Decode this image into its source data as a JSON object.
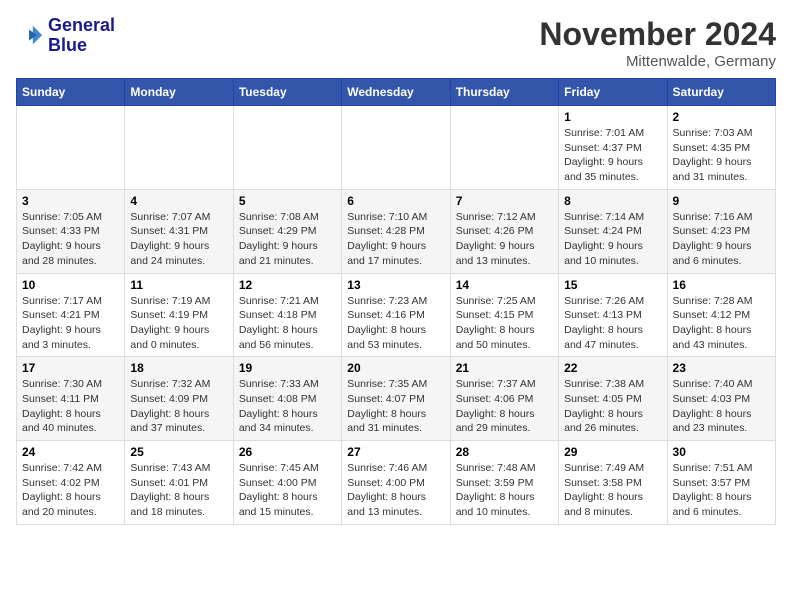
{
  "header": {
    "logo_line1": "General",
    "logo_line2": "Blue",
    "month_title": "November 2024",
    "location": "Mittenwalde, Germany"
  },
  "weekdays": [
    "Sunday",
    "Monday",
    "Tuesday",
    "Wednesday",
    "Thursday",
    "Friday",
    "Saturday"
  ],
  "weeks": [
    [
      {
        "day": "",
        "info": ""
      },
      {
        "day": "",
        "info": ""
      },
      {
        "day": "",
        "info": ""
      },
      {
        "day": "",
        "info": ""
      },
      {
        "day": "",
        "info": ""
      },
      {
        "day": "1",
        "info": "Sunrise: 7:01 AM\nSunset: 4:37 PM\nDaylight: 9 hours\nand 35 minutes."
      },
      {
        "day": "2",
        "info": "Sunrise: 7:03 AM\nSunset: 4:35 PM\nDaylight: 9 hours\nand 31 minutes."
      }
    ],
    [
      {
        "day": "3",
        "info": "Sunrise: 7:05 AM\nSunset: 4:33 PM\nDaylight: 9 hours\nand 28 minutes."
      },
      {
        "day": "4",
        "info": "Sunrise: 7:07 AM\nSunset: 4:31 PM\nDaylight: 9 hours\nand 24 minutes."
      },
      {
        "day": "5",
        "info": "Sunrise: 7:08 AM\nSunset: 4:29 PM\nDaylight: 9 hours\nand 21 minutes."
      },
      {
        "day": "6",
        "info": "Sunrise: 7:10 AM\nSunset: 4:28 PM\nDaylight: 9 hours\nand 17 minutes."
      },
      {
        "day": "7",
        "info": "Sunrise: 7:12 AM\nSunset: 4:26 PM\nDaylight: 9 hours\nand 13 minutes."
      },
      {
        "day": "8",
        "info": "Sunrise: 7:14 AM\nSunset: 4:24 PM\nDaylight: 9 hours\nand 10 minutes."
      },
      {
        "day": "9",
        "info": "Sunrise: 7:16 AM\nSunset: 4:23 PM\nDaylight: 9 hours\nand 6 minutes."
      }
    ],
    [
      {
        "day": "10",
        "info": "Sunrise: 7:17 AM\nSunset: 4:21 PM\nDaylight: 9 hours\nand 3 minutes."
      },
      {
        "day": "11",
        "info": "Sunrise: 7:19 AM\nSunset: 4:19 PM\nDaylight: 9 hours\nand 0 minutes."
      },
      {
        "day": "12",
        "info": "Sunrise: 7:21 AM\nSunset: 4:18 PM\nDaylight: 8 hours\nand 56 minutes."
      },
      {
        "day": "13",
        "info": "Sunrise: 7:23 AM\nSunset: 4:16 PM\nDaylight: 8 hours\nand 53 minutes."
      },
      {
        "day": "14",
        "info": "Sunrise: 7:25 AM\nSunset: 4:15 PM\nDaylight: 8 hours\nand 50 minutes."
      },
      {
        "day": "15",
        "info": "Sunrise: 7:26 AM\nSunset: 4:13 PM\nDaylight: 8 hours\nand 47 minutes."
      },
      {
        "day": "16",
        "info": "Sunrise: 7:28 AM\nSunset: 4:12 PM\nDaylight: 8 hours\nand 43 minutes."
      }
    ],
    [
      {
        "day": "17",
        "info": "Sunrise: 7:30 AM\nSunset: 4:11 PM\nDaylight: 8 hours\nand 40 minutes."
      },
      {
        "day": "18",
        "info": "Sunrise: 7:32 AM\nSunset: 4:09 PM\nDaylight: 8 hours\nand 37 minutes."
      },
      {
        "day": "19",
        "info": "Sunrise: 7:33 AM\nSunset: 4:08 PM\nDaylight: 8 hours\nand 34 minutes."
      },
      {
        "day": "20",
        "info": "Sunrise: 7:35 AM\nSunset: 4:07 PM\nDaylight: 8 hours\nand 31 minutes."
      },
      {
        "day": "21",
        "info": "Sunrise: 7:37 AM\nSunset: 4:06 PM\nDaylight: 8 hours\nand 29 minutes."
      },
      {
        "day": "22",
        "info": "Sunrise: 7:38 AM\nSunset: 4:05 PM\nDaylight: 8 hours\nand 26 minutes."
      },
      {
        "day": "23",
        "info": "Sunrise: 7:40 AM\nSunset: 4:03 PM\nDaylight: 8 hours\nand 23 minutes."
      }
    ],
    [
      {
        "day": "24",
        "info": "Sunrise: 7:42 AM\nSunset: 4:02 PM\nDaylight: 8 hours\nand 20 minutes."
      },
      {
        "day": "25",
        "info": "Sunrise: 7:43 AM\nSunset: 4:01 PM\nDaylight: 8 hours\nand 18 minutes."
      },
      {
        "day": "26",
        "info": "Sunrise: 7:45 AM\nSunset: 4:00 PM\nDaylight: 8 hours\nand 15 minutes."
      },
      {
        "day": "27",
        "info": "Sunrise: 7:46 AM\nSunset: 4:00 PM\nDaylight: 8 hours\nand 13 minutes."
      },
      {
        "day": "28",
        "info": "Sunrise: 7:48 AM\nSunset: 3:59 PM\nDaylight: 8 hours\nand 10 minutes."
      },
      {
        "day": "29",
        "info": "Sunrise: 7:49 AM\nSunset: 3:58 PM\nDaylight: 8 hours\nand 8 minutes."
      },
      {
        "day": "30",
        "info": "Sunrise: 7:51 AM\nSunset: 3:57 PM\nDaylight: 8 hours\nand 6 minutes."
      }
    ]
  ]
}
